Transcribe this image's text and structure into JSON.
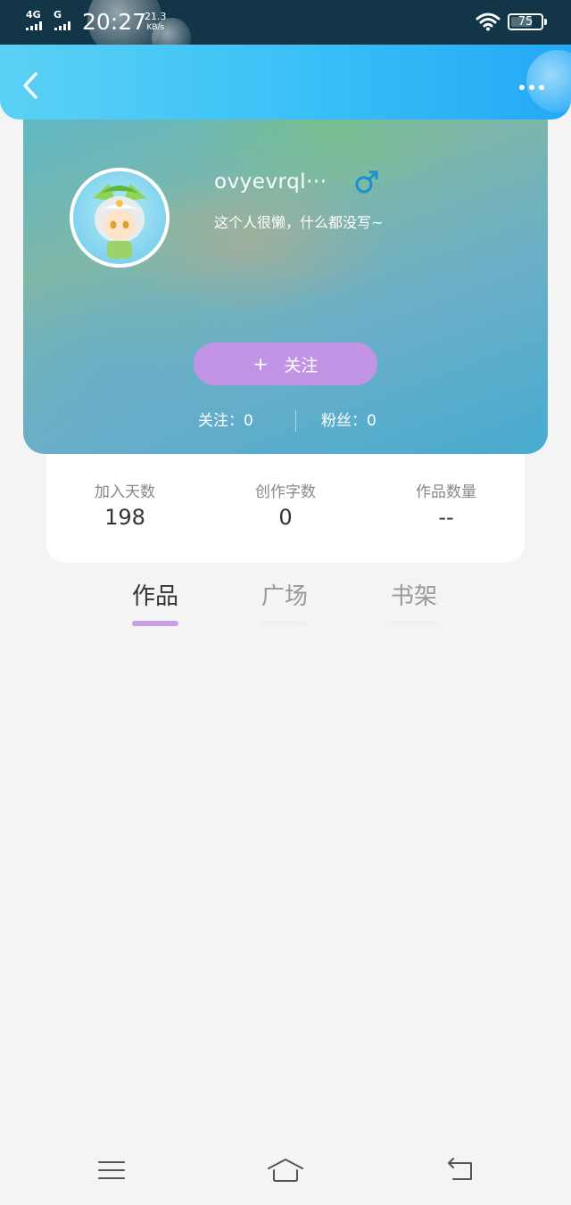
{
  "status_bar": {
    "network_1": "4G",
    "network_2": "G",
    "time": "20:27",
    "speed_value": "21.3",
    "speed_unit": "KB/s",
    "battery": "75",
    "battery_level": 0.75
  },
  "header": {
    "back_icon": "chevron-left-icon",
    "more_icon": "more-horizontal-icon"
  },
  "profile": {
    "username": "ovyevrql···",
    "gender_icon": "male-icon",
    "gender_color": "#1a8fd1",
    "bio": "这个人很懒，什么都没写~",
    "follow_plus": "+",
    "follow_label": "关注",
    "following_text": "关注：0",
    "fans_text": "粉丝：0"
  },
  "stats": [
    {
      "label": "加入天数",
      "value": "198"
    },
    {
      "label": "创作字数",
      "value": "0"
    },
    {
      "label": "作品数量",
      "value": "--"
    }
  ],
  "tabs": [
    {
      "label": "作品",
      "active": true
    },
    {
      "label": "广场",
      "active": false
    },
    {
      "label": "书架",
      "active": false
    }
  ],
  "colors": {
    "header_gradient_start": "#5bd1f4",
    "header_gradient_end": "#23a9f6",
    "follow_button": "#c194e6",
    "tab_indicator": "#c5a0e6"
  },
  "nav_bar": {
    "menu_icon": "menu-icon",
    "home_icon": "home-icon",
    "back_icon": "back-arrow-icon"
  }
}
